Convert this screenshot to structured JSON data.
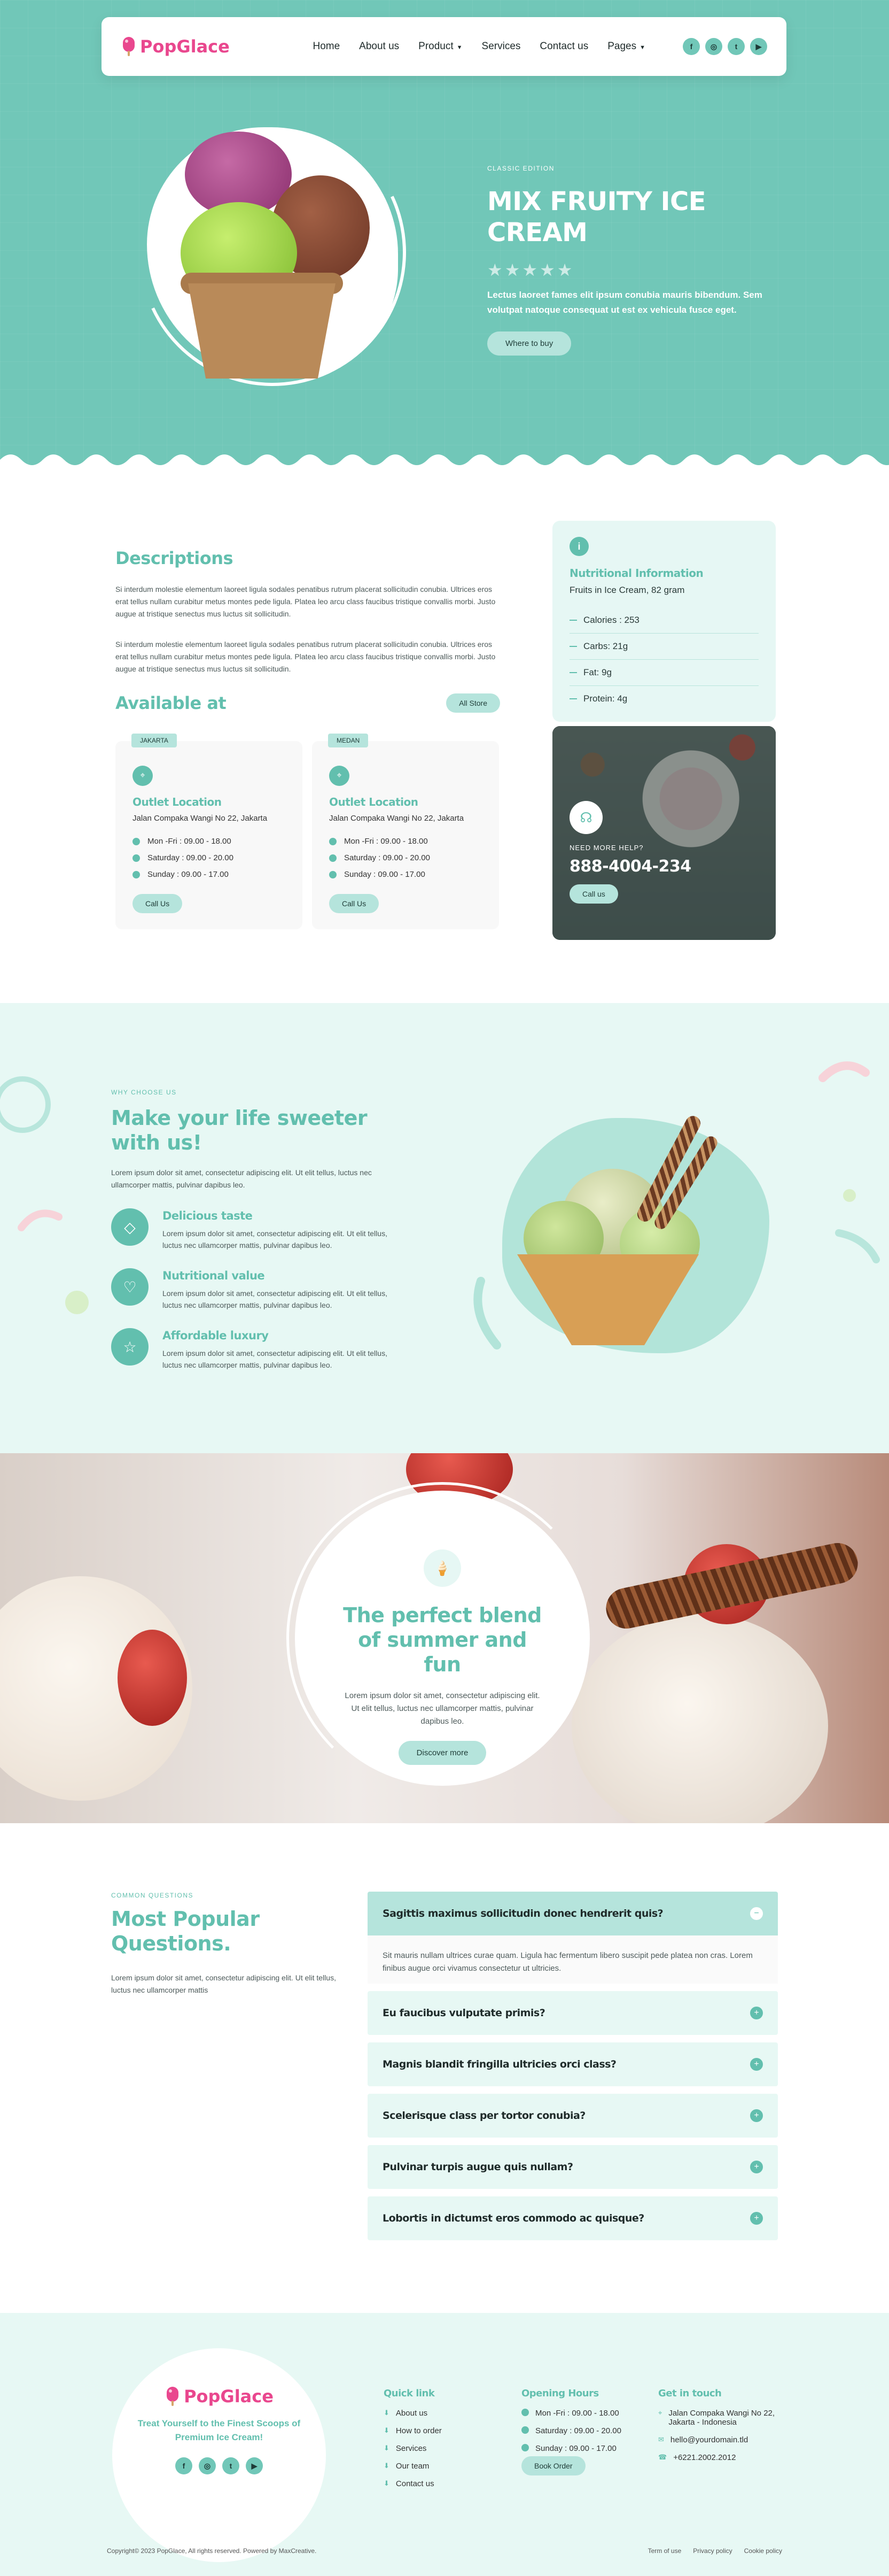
{
  "brand": {
    "name": "PopGlace",
    "accent": "#62bfae",
    "hero_bg": "#71c7b8",
    "logo_color": "#e9478e"
  },
  "nav": {
    "items": [
      {
        "label": "Home",
        "dropdown": false
      },
      {
        "label": "About us",
        "dropdown": false
      },
      {
        "label": "Product",
        "dropdown": true
      },
      {
        "label": "Services",
        "dropdown": false
      },
      {
        "label": "Contact us",
        "dropdown": false
      },
      {
        "label": "Pages",
        "dropdown": true
      }
    ],
    "socials": [
      "facebook-icon",
      "instagram-icon",
      "twitter-icon",
      "youtube-icon"
    ]
  },
  "hero": {
    "eyebrow": "CLASSIC EDITION",
    "title": "MIX FRUITY ICE CREAM",
    "rating": 0,
    "rating_max": 5,
    "description": "Lectus laoreet fames elit ipsum conubia mauris bibendum. Sem volutpat natoque consequat ut est ex vehicula fusce eget.",
    "cta": "Where to buy"
  },
  "descriptions": {
    "title": "Descriptions",
    "paragraphs": [
      "Si interdum molestie elementum laoreet ligula sodales penatibus rutrum placerat sollicitudin conubia. Ultrices eros erat tellus nullam curabitur metus montes pede ligula. Platea leo arcu class faucibus tristique convallis morbi. Justo augue at tristique senectus mus luctus sit sollicitudin.",
      "Si interdum molestie elementum laoreet ligula sodales penatibus rutrum placerat sollicitudin conubia. Ultrices eros erat tellus nullam curabitur metus montes pede ligula. Platea leo arcu class faucibus tristique convallis morbi. Justo augue at tristique senectus mus luctus sit sollicitudin."
    ]
  },
  "available": {
    "title": "Available at",
    "all_store": "All Store",
    "outlets": [
      {
        "tag": "JAKARTA",
        "title": "Outlet Location",
        "address": "Jalan Compaka Wangi No 22, Jakarta",
        "hours": [
          "Mon -Fri : 09.00 - 18.00",
          "Saturday : 09.00 - 20.00",
          "Sunday : 09.00 - 17.00"
        ],
        "button": "Call Us"
      },
      {
        "tag": "MEDAN",
        "title": "Outlet Location",
        "address": "Jalan Compaka Wangi No 22, Jakarta",
        "hours": [
          "Mon -Fri : 09.00 - 18.00",
          "Saturday : 09.00 - 20.00",
          "Sunday : 09.00 - 17.00"
        ],
        "button": "Call Us"
      }
    ]
  },
  "nutrition": {
    "title": "Nutritional Information",
    "subtitle": "Fruits in Ice Cream, 82 gram",
    "rows": [
      "Calories : 253",
      "Carbs: 21g",
      "Fat: 9g",
      "Protein: 4g"
    ]
  },
  "help": {
    "eyebrow": "NEED MORE HELP?",
    "phone": "888-4004-234",
    "button": "Call us"
  },
  "why": {
    "eyebrow": "WHY CHOOSE US",
    "title": "Make your life sweeter with us!",
    "intro": "Lorem ipsum dolor sit amet, consectetur adipiscing elit. Ut elit tellus, luctus nec ullamcorper mattis, pulvinar dapibus leo.",
    "features": [
      {
        "icon": "diamond-icon",
        "title": "Delicious taste",
        "text": "Lorem ipsum dolor sit amet, consectetur adipiscing elit. Ut elit tellus, luctus nec ullamcorper mattis, pulvinar dapibus leo."
      },
      {
        "icon": "heart-icon",
        "title": "Nutritional value",
        "text": "Lorem ipsum dolor sit amet, consectetur adipiscing elit. Ut elit tellus, luctus nec ullamcorper mattis, pulvinar dapibus leo."
      },
      {
        "icon": "star-icon",
        "title": "Affordable luxury",
        "text": "Lorem ipsum dolor sit amet, consectetur adipiscing elit. Ut elit tellus, luctus nec ullamcorper mattis, pulvinar dapibus leo."
      }
    ]
  },
  "blend": {
    "title": "The perfect blend of summer and fun",
    "text": "Lorem ipsum dolor sit amet, consectetur adipiscing elit. Ut elit tellus, luctus nec ullamcorper mattis, pulvinar dapibus leo.",
    "button": "Discover more"
  },
  "faq": {
    "eyebrow": "COMMON QUESTIONS",
    "title": "Most Popular Questions.",
    "intro": "Lorem ipsum dolor sit amet, consectetur adipiscing elit. Ut elit tellus, luctus nec ullamcorper mattis",
    "items": [
      {
        "q": "Sagittis maximus sollicitudin donec hendrerit quis?",
        "open": true,
        "a": "Sit mauris nullam ultrices curae quam. Ligula hac fermentum libero suscipit pede platea non cras. Lorem finibus augue orci vivamus consectetur ut ultricies."
      },
      {
        "q": "Eu faucibus vulputate primis?",
        "open": false
      },
      {
        "q": "Magnis blandit fringilla ultricies orci class?",
        "open": false
      },
      {
        "q": "Scelerisque class per tortor conubia?",
        "open": false
      },
      {
        "q": "Pulvinar turpis augue quis nullam?",
        "open": false
      },
      {
        "q": "Lobortis in dictumst eros commodo ac quisque?",
        "open": false
      }
    ]
  },
  "footer": {
    "tagline": "Treat Yourself to the Finest Scoops of Premium Ice Cream!",
    "quick_title": "Quick link",
    "quick_links": [
      "About us",
      "How to order",
      "Services",
      "Our team",
      "Contact us"
    ],
    "hours_title": "Opening Hours",
    "hours": [
      "Mon -Fri : 09.00 - 18.00",
      "Saturday : 09.00 - 20.00",
      "Sunday : 09.00 - 17.00"
    ],
    "book_button": "Book Order",
    "touch_title": "Get in touch",
    "contact": [
      {
        "icon": "map-pin-icon",
        "text": "Jalan Compaka Wangi No 22, Jakarta - Indonesia"
      },
      {
        "icon": "mail-icon",
        "text": "hello@yourdomain.tld"
      },
      {
        "icon": "phone-icon",
        "text": "+6221.2002.2012"
      }
    ],
    "copyright": "Copyright© 2023 PopGlace, All rights reserved. Powered by MaxCreative.",
    "legal": [
      "Term of use",
      "Privacy policy",
      "Cookie policy"
    ]
  }
}
